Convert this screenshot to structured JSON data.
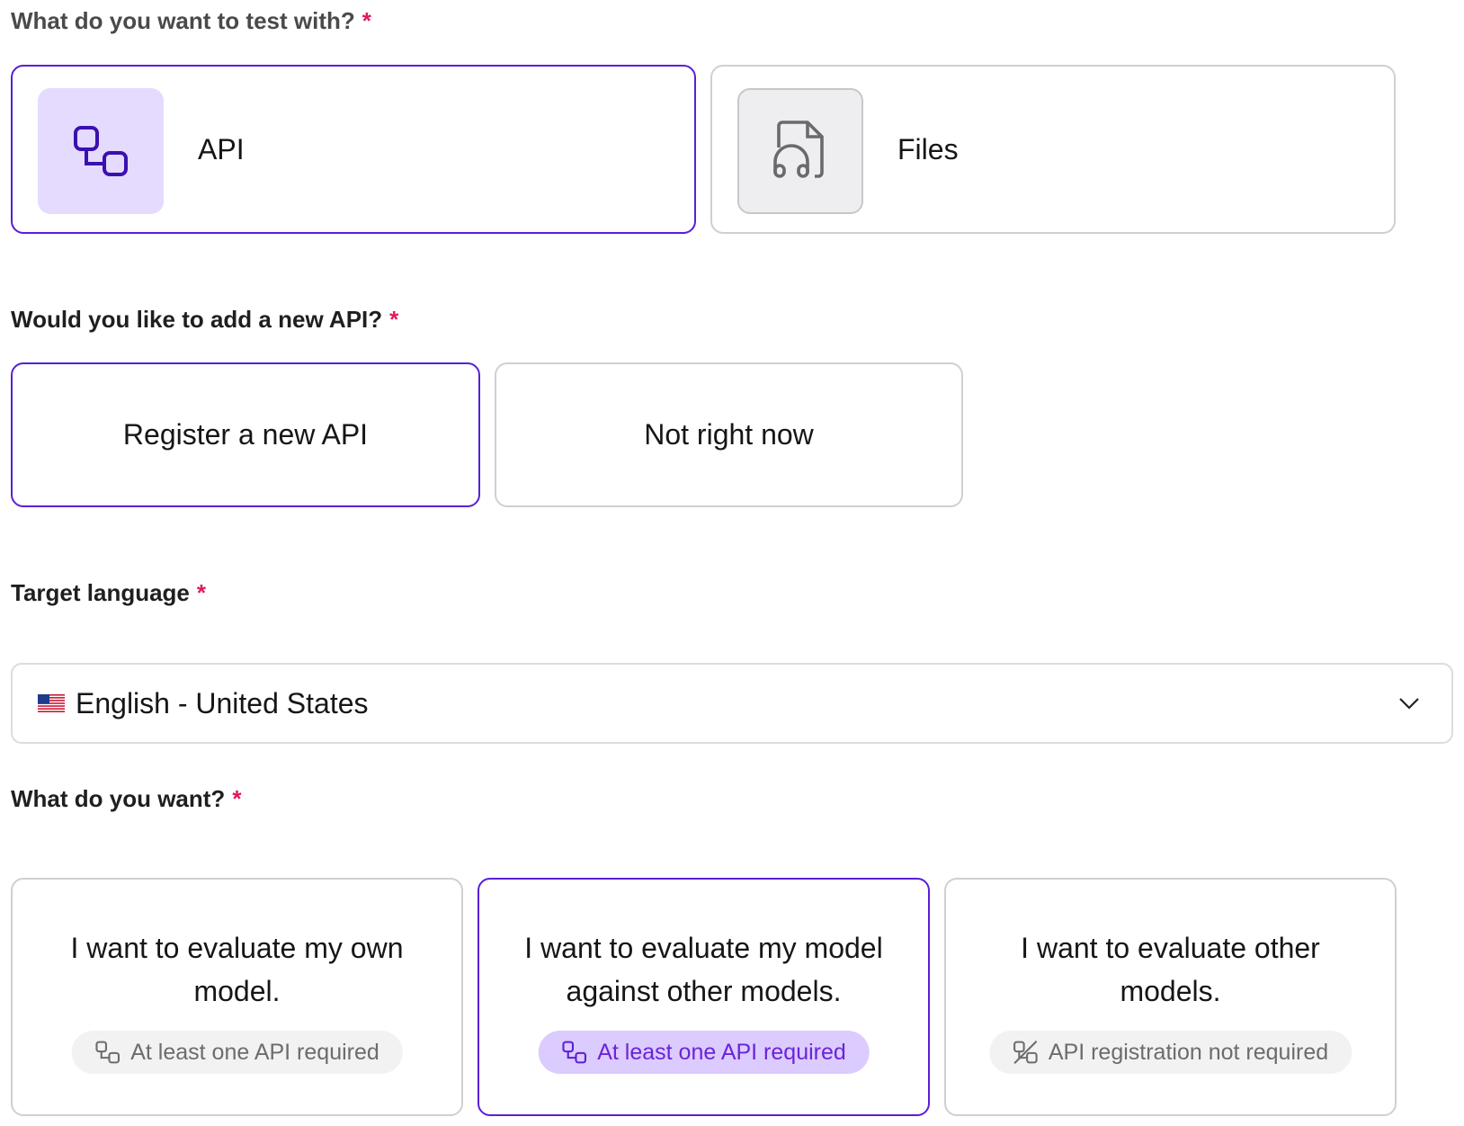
{
  "q1": {
    "label": "What do you want to test with?",
    "required": "*"
  },
  "source_options": [
    {
      "label": "API",
      "icon": "api-icon",
      "selected": true
    },
    {
      "label": "Files",
      "icon": "audio-file-icon",
      "selected": false
    }
  ],
  "q2": {
    "label": "Would you like to add a new API?",
    "required": "*"
  },
  "api_choices": [
    {
      "label": "Register a new API",
      "selected": true
    },
    {
      "label": "Not right now",
      "selected": false
    }
  ],
  "q3": {
    "label": "Target language",
    "required": "*"
  },
  "language": {
    "flag": "us-flag-icon",
    "value": "English - United States"
  },
  "q4": {
    "label": "What do you want?",
    "required": "*"
  },
  "want_options": [
    {
      "title": "I want to evaluate my own model.",
      "badge": "At least one API required",
      "badge_icon": "api-icon",
      "selected": false
    },
    {
      "title": "I want to evaluate my model against other models.",
      "badge": "At least one API required",
      "badge_icon": "api-icon",
      "selected": true
    },
    {
      "title": "I want to evaluate other models.",
      "badge": "API registration not required",
      "badge_icon": "api-not-required-icon",
      "selected": false
    }
  ],
  "colors": {
    "accent": "#5a1fd6",
    "required": "#e0185c",
    "badge_purple_bg": "#dccbff",
    "icon_purple_bg": "#e5dbff"
  }
}
